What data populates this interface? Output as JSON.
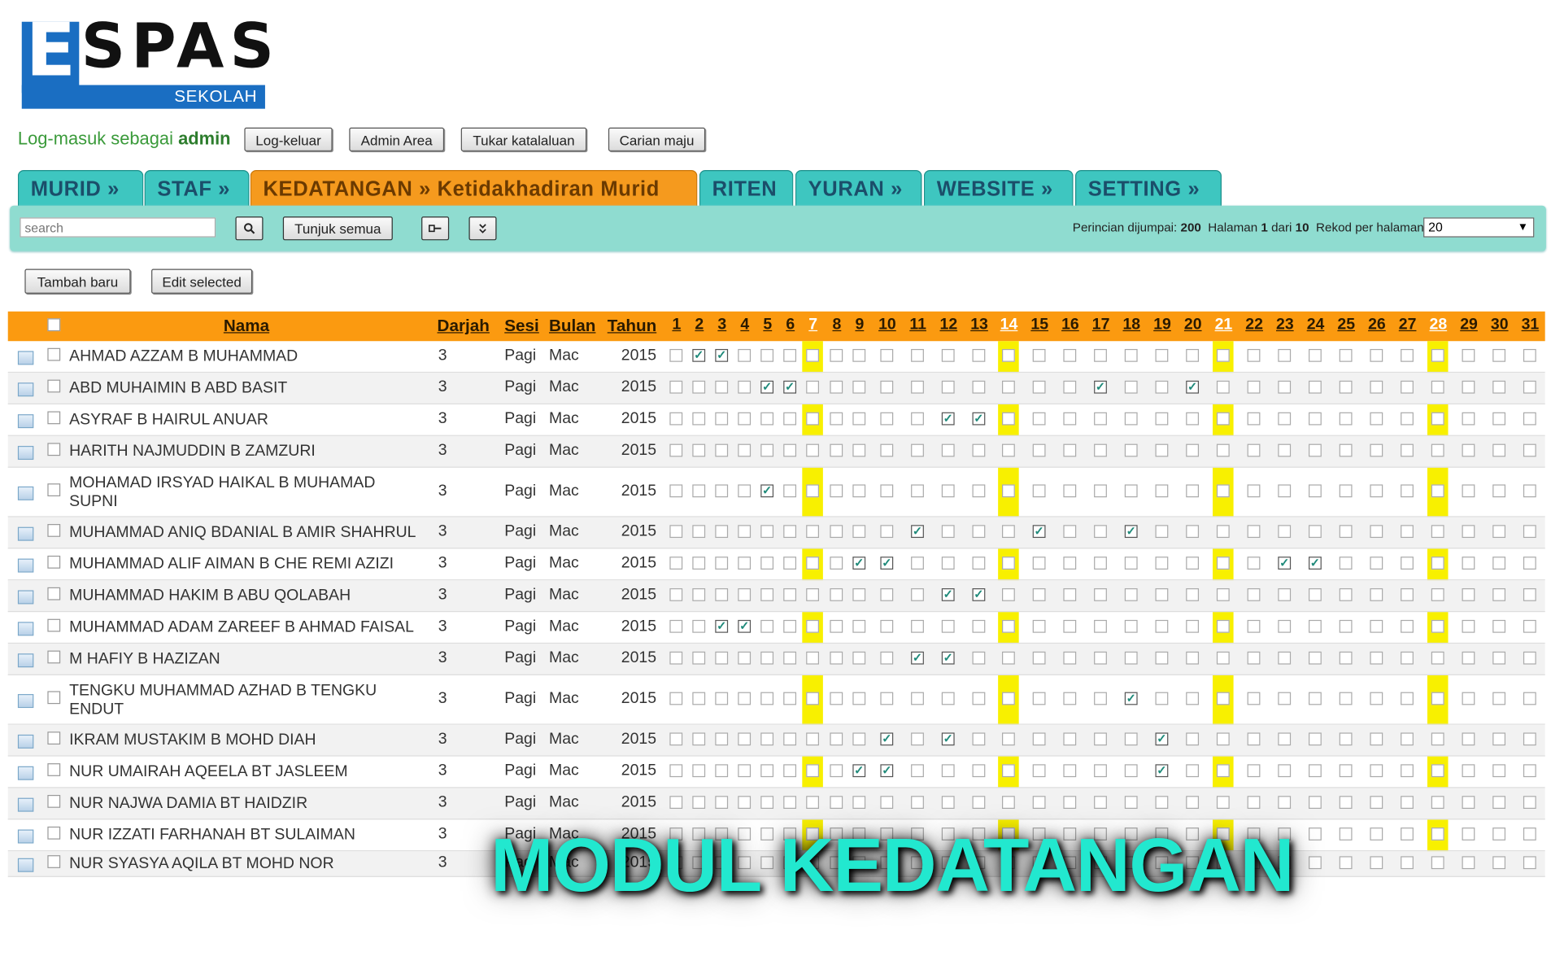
{
  "logo": {
    "letter_e": "E",
    "letters": "SPAS",
    "sub": "SEKOLAH"
  },
  "login": {
    "prefix": "Log-masuk sebagai",
    "user": "admin"
  },
  "top_buttons": [
    "Log-keluar",
    "Admin Area",
    "Tukar katalaluan",
    "Carian maju"
  ],
  "tabs": [
    "MURID »",
    "STAF »",
    "KEDATANGAN » Ketidakhadiran Murid",
    "RITEN",
    "YURAN »",
    "WEBSITE »",
    "SETTING »"
  ],
  "toolbar": {
    "search_placeholder": "search",
    "show_all": "Tunjuk semua",
    "info_found_label": "Perincian dijumpai:",
    "info_found": "200",
    "info_page_label": "Halaman",
    "info_page": "1",
    "info_of": "dari",
    "info_pages": "10",
    "info_perpage_label": "Rekod per halaman:",
    "per_page": "20"
  },
  "actions": {
    "add": "Tambah baru",
    "edit": "Edit selected"
  },
  "table": {
    "headers": {
      "nama": "Nama",
      "darjah": "Darjah",
      "sesi": "Sesi",
      "bulan": "Bulan",
      "tahun": "Tahun"
    },
    "days": [
      "1",
      "2",
      "3",
      "4",
      "5",
      "6",
      "7",
      "8",
      "9",
      "10",
      "11",
      "12",
      "13",
      "14",
      "15",
      "16",
      "17",
      "18",
      "19",
      "20",
      "21",
      "22",
      "23",
      "24",
      "25",
      "26",
      "27",
      "28",
      "29",
      "30",
      "31"
    ],
    "weekend_days": [
      7,
      14,
      21,
      28
    ],
    "rows": [
      {
        "name": "AHMAD AZZAM B MUHAMMAD",
        "darjah": "3",
        "sesi": "Pagi",
        "bulan": "Mac",
        "tahun": "2015",
        "absent": [
          2,
          3
        ]
      },
      {
        "name": "ABD MUHAIMIN B ABD BASIT",
        "darjah": "3",
        "sesi": "Pagi",
        "bulan": "Mac",
        "tahun": "2015",
        "absent": [
          5,
          6,
          17,
          20
        ]
      },
      {
        "name": "ASYRAF B HAIRUL ANUAR",
        "darjah": "3",
        "sesi": "Pagi",
        "bulan": "Mac",
        "tahun": "2015",
        "absent": [
          12,
          13
        ]
      },
      {
        "name": "HARITH NAJMUDDIN B ZAMZURI",
        "darjah": "3",
        "sesi": "Pagi",
        "bulan": "Mac",
        "tahun": "2015",
        "absent": []
      },
      {
        "name": "MOHAMAD IRSYAD HAIKAL B MUHAMAD",
        "name2": "SUPNI",
        "darjah": "3",
        "sesi": "Pagi",
        "bulan": "Mac",
        "tahun": "2015",
        "absent": [
          5
        ]
      },
      {
        "name": "MUHAMMAD ANIQ BDANIAL B AMIR SHAHRUL",
        "darjah": "3",
        "sesi": "Pagi",
        "bulan": "Mac",
        "tahun": "2015",
        "absent": [
          11,
          15,
          18
        ]
      },
      {
        "name": "MUHAMMAD ALIF AIMAN B CHE REMI AZIZI",
        "darjah": "3",
        "sesi": "Pagi",
        "bulan": "Mac",
        "tahun": "2015",
        "absent": [
          9,
          10,
          23,
          24
        ]
      },
      {
        "name": "MUHAMMAD HAKIM B ABU QOLABAH",
        "darjah": "3",
        "sesi": "Pagi",
        "bulan": "Mac",
        "tahun": "2015",
        "absent": [
          12,
          13
        ]
      },
      {
        "name": "MUHAMMAD ADAM ZAREEF B AHMAD FAISAL",
        "darjah": "3",
        "sesi": "Pagi",
        "bulan": "Mac",
        "tahun": "2015",
        "absent": [
          3,
          4
        ]
      },
      {
        "name": "M HAFIY B HAZIZAN",
        "darjah": "3",
        "sesi": "Pagi",
        "bulan": "Mac",
        "tahun": "2015",
        "absent": [
          11,
          12
        ]
      },
      {
        "name": "TENGKU MUHAMMAD AZHAD B TENGKU",
        "name2": "ENDUT",
        "darjah": "3",
        "sesi": "Pagi",
        "bulan": "Mac",
        "tahun": "2015",
        "absent": [
          18
        ]
      },
      {
        "name": "IKRAM MUSTAKIM B MOHD DIAH",
        "darjah": "3",
        "sesi": "Pagi",
        "bulan": "Mac",
        "tahun": "2015",
        "absent": [
          10,
          12,
          19
        ]
      },
      {
        "name": "NUR UMAIRAH AQEELA BT JASLEEM",
        "darjah": "3",
        "sesi": "Pagi",
        "bulan": "Mac",
        "tahun": "2015",
        "absent": [
          9,
          10,
          19
        ]
      },
      {
        "name": "NUR NAJWA DAMIA BT HAIDZIR",
        "darjah": "3",
        "sesi": "Pagi",
        "bulan": "Mac",
        "tahun": "2015",
        "absent": []
      },
      {
        "name": "NUR IZZATI FARHANAH BT SULAIMAN",
        "darjah": "3",
        "sesi": "Pagi",
        "bulan": "Mac",
        "tahun": "2015",
        "absent": []
      },
      {
        "name": "NUR SYASYA AQILA BT MOHD NOR",
        "darjah": "3",
        "sesi": "Pagi",
        "bulan": "Mac",
        "tahun": "2015",
        "absent": []
      }
    ]
  },
  "banner": "MODUL KEDATANGAN",
  "colors": {
    "teal": "#3ec6c0",
    "orange": "#f59a1e",
    "weekend": "#f8f000",
    "banner": "#22e8cf",
    "brand_blue": "#1a6ec2"
  }
}
